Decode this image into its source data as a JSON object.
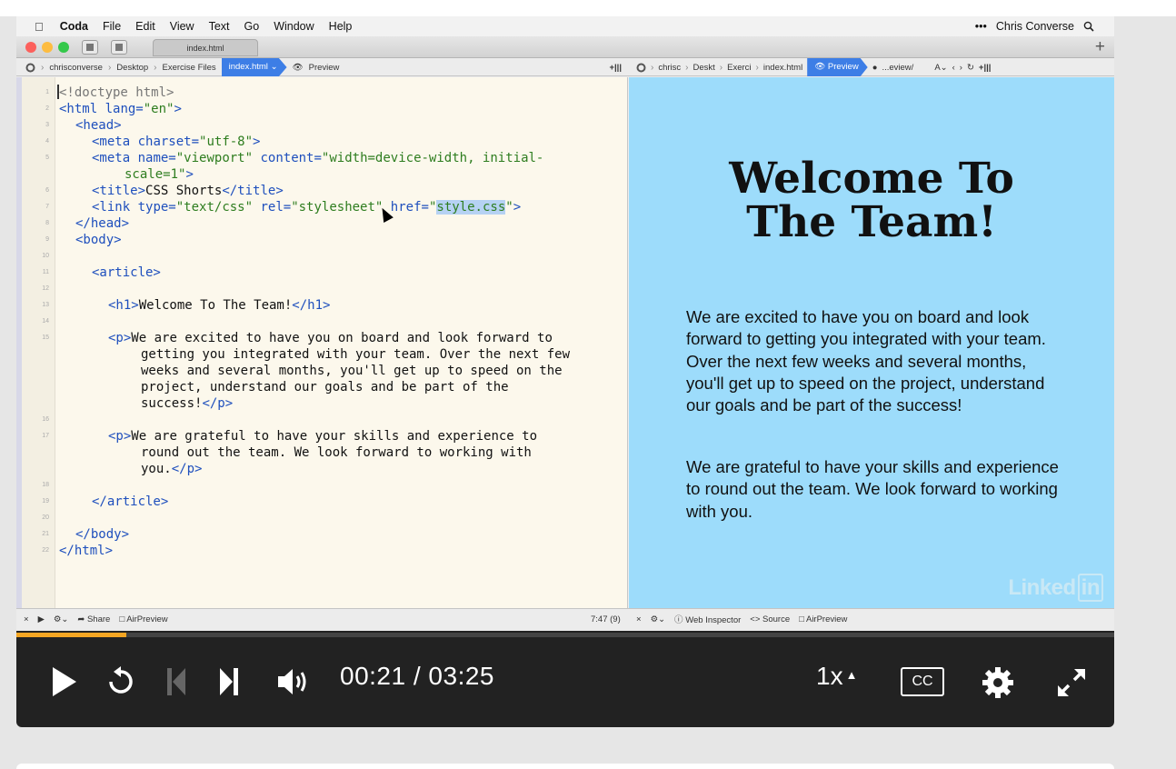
{
  "os_menu": {
    "apple_icon": "apple-logo",
    "app_name": "Coda",
    "items": [
      "File",
      "Edit",
      "View",
      "Text",
      "Go",
      "Window",
      "Help"
    ],
    "user": "Chris Converse",
    "more": "•••"
  },
  "window": {
    "tab_title": "index.html",
    "new_tab": "+"
  },
  "left_path": {
    "crumbs": [
      "chrisconverse",
      "Desktop",
      "Exercise Files"
    ],
    "active": "index.html",
    "preview": "Preview",
    "split": "+|||"
  },
  "right_path": {
    "crumbs": [
      "chrisc",
      "Deskt",
      "Exerci",
      "index.html"
    ],
    "active": "Preview",
    "url": "...eview/",
    "split": "+|||"
  },
  "editor": {
    "line_numbers": [
      "1",
      "2",
      "3",
      "4",
      "5",
      "",
      "6",
      "7",
      "8",
      "9",
      "10",
      "11",
      "12",
      "13",
      "14",
      "15",
      "",
      "",
      "",
      "",
      "16",
      "17",
      "",
      "",
      "18",
      "19",
      "20",
      "21",
      "22"
    ],
    "cursor_position": "7:47 (9)"
  },
  "preview": {
    "heading_line1": "Welcome To",
    "heading_line2": "The Team!",
    "paragraph1": "We are excited to have you on board and look forward to getting you integrated with your team. Over the next few weeks and several months, you'll get up to speed on the project, understand our goals and be part of the success!",
    "paragraph2": "We are grateful to have your skills and experience to round out the team. We look forward to working with you.",
    "watermark_text": "Linked",
    "watermark_in": "in"
  },
  "statusbar": {
    "left_items": [
      "Share",
      "AirPreview"
    ],
    "right_items": [
      "Web Inspector",
      "Source",
      "AirPreview"
    ]
  },
  "player": {
    "current_time": "00:21",
    "separator": "/",
    "duration": "03:25",
    "speed": "1x",
    "cc": "CC",
    "progress_fraction": 0.1,
    "accent_color": "#f5a623"
  }
}
